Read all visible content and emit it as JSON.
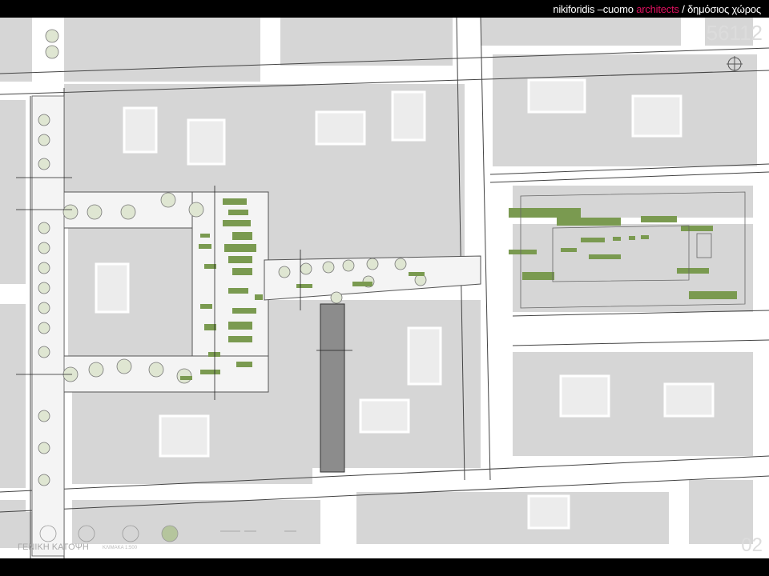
{
  "header": {
    "firm_part1": "nikiforidis –cuomo",
    "firm_accent": "architects",
    "separator": " / ",
    "subtitle": "δημόσιος χώρος"
  },
  "project_number": "56112",
  "page_number": "02",
  "plan": {
    "title": "ΓΕΝΙΚΗ ΚΑΤΟΨΗ",
    "scale": "ΚΛΙΜΑΚΑ 1:500"
  },
  "colors": {
    "header_bg": "#000000",
    "accent": "#e0115f",
    "sheet_bg": "#ffffff",
    "building": "#d6d6d6",
    "street": "#ffffff",
    "planting": "#7a9a50",
    "tree_fill": "#dfe6d2",
    "paving": "#8c8c8c",
    "outline": "#555555"
  }
}
